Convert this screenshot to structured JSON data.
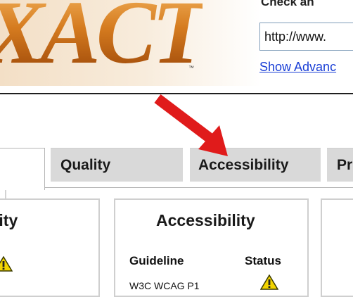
{
  "header": {
    "logo_text": "XACT",
    "trademark": "™",
    "check_title": "Check an",
    "url_value": "http://www.",
    "advanced_link": "Show Advanc"
  },
  "tabs": [
    {
      "label": ""
    },
    {
      "label": "Quality"
    },
    {
      "label": "Accessibility"
    },
    {
      "label": "Pr"
    }
  ],
  "panels": {
    "left": {
      "title": "lity"
    },
    "accessibility": {
      "title": "Accessibility",
      "columns": [
        "Guideline",
        "Status"
      ],
      "rows": [
        {
          "guideline": "W3C WCAG P1",
          "status_icon": "warning-icon"
        }
      ]
    }
  },
  "colors": {
    "accent_red": "#e01b1b",
    "link_blue": "#1a3fd6",
    "tab_gray": "#d9d9d9",
    "warning_yellow": "#f2d400"
  }
}
